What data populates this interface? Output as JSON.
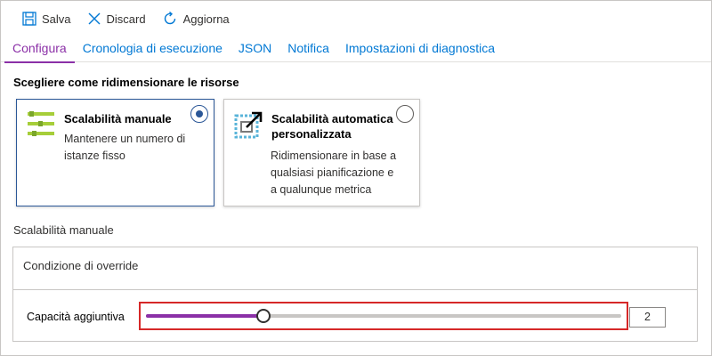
{
  "toolbar": {
    "save_label": "Salva",
    "discard_label": "Discard",
    "refresh_label": "Aggiorna"
  },
  "tabs": [
    {
      "label": "Configura",
      "active": true
    },
    {
      "label": "Cronologia di esecuzione",
      "active": false
    },
    {
      "label": "JSON",
      "active": false
    },
    {
      "label": "Notifica",
      "active": false
    },
    {
      "label": "Impostazioni di diagnostica",
      "active": false
    }
  ],
  "section_title": "Scegliere come ridimensionare le risorse",
  "cards": {
    "manual": {
      "title": "Scalabilità manuale",
      "description_line1": "Mantenere un numero di",
      "description_line2": "istanze fisso",
      "selected": true
    },
    "auto": {
      "title_line1": "Scalabilità automatica",
      "title_line2": "personalizzata",
      "description_line1": "Ridimensionare in base a",
      "description_line2": "qualsiasi pianificazione e",
      "description_line3": "a qualunque metrica",
      "selected": false
    }
  },
  "manual_scale": {
    "section_label": "Scalabilità manuale",
    "override_label": "Condizione di override",
    "capacity_label": "Capacità aggiuntiva",
    "slider_fraction": 0.247,
    "value": "2"
  },
  "colors": {
    "accent": "#8b30a7",
    "link": "#0078d4",
    "selected_border": "#2b5797",
    "highlight_box": "#d62828"
  },
  "icons": {
    "save": "save-icon",
    "discard": "close-icon",
    "refresh": "refresh-icon",
    "manual": "manual-scale-icon",
    "auto": "autoscale-icon"
  }
}
